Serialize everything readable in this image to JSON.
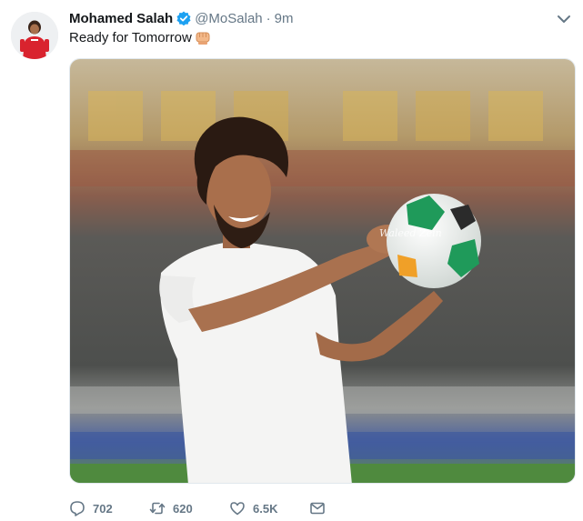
{
  "tweet": {
    "author_name": "Mohamed Salah",
    "handle": "@MoSalah",
    "separator": "·",
    "time": "9m",
    "text": "Ready for Tomorrow",
    "text_emoji": "fist-icon",
    "media_watermark": "Waleed Zein"
  },
  "actions": {
    "reply_count": "702",
    "retweet_count": "620",
    "like_count": "6.5K"
  },
  "colors": {
    "verified": "#1da1f2",
    "secondary_text": "#657786",
    "primary_text": "#14171a"
  }
}
